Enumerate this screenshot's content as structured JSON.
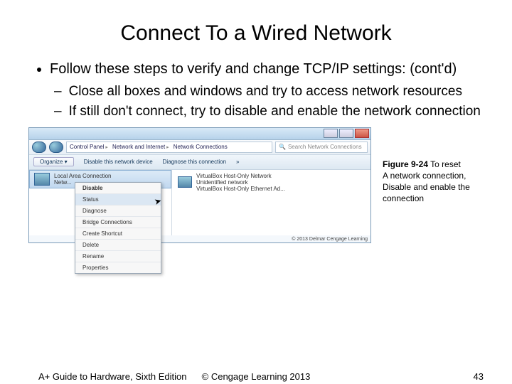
{
  "title": "Connect To a Wired Network",
  "bullet_main": "Follow these steps to verify and change TCP/IP settings: (cont'd)",
  "sub1": "Close all boxes and windows and try to access network resources",
  "sub2": "If still don't connect, try to disable and enable the network connection",
  "breadcrumb": {
    "a": "Control Panel",
    "b": "Network and Internet",
    "c": "Network Connections"
  },
  "search_placeholder": "Search Network Connections",
  "toolbar": {
    "organize": "Organize ▾",
    "disable": "Disable this network device",
    "diagnose": "Diagnose this connection",
    "more": "»"
  },
  "left_item": {
    "name": "Local Area Connection",
    "status": "Netw..."
  },
  "right_item": {
    "name": "VirtualBox Host-Only Network",
    "line2": "Unidentified network",
    "line3": "VirtualBox Host-Only Ethernet Ad..."
  },
  "menu": {
    "disable": "Disable",
    "status": "Status",
    "diagnose": "Diagnose",
    "bridge": "Bridge Connections",
    "shortcut": "Create Shortcut",
    "delete": "Delete",
    "rename": "Rename",
    "properties": "Properties"
  },
  "figure_copyright": "© 2013 Delmar Cengage Learning",
  "caption": {
    "label": "Figure 9-24",
    "text1": "To reset",
    "text2": "A network connection,",
    "text3": "Disable and enable the",
    "text4": "connection"
  },
  "footer": {
    "left": "A+ Guide to Hardware, Sixth Edition",
    "center": "© Cengage Learning  2013",
    "page": "43"
  }
}
